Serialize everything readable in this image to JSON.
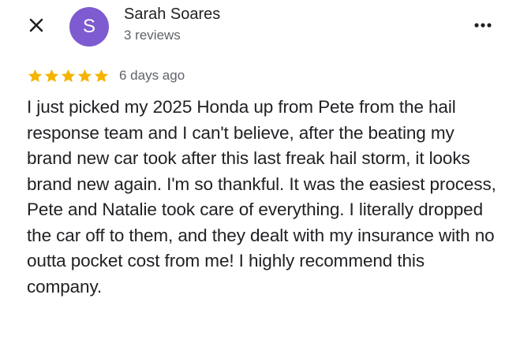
{
  "header": {
    "close_icon": "close-icon",
    "avatar_initial": "S",
    "avatar_color": "#7e5bd0",
    "author_name": "Sarah Soares",
    "author_meta": "3 reviews",
    "more_icon": "more-horizontal-icon"
  },
  "review": {
    "rating": 5,
    "rating_max": 5,
    "star_color": "#f4b400",
    "date": "6 days ago",
    "text": "I just picked my 2025 Honda up from Pete from the hail response team and I can't believe, after the beating my brand new car took after this last freak hail storm, it looks brand new again. I'm so thankful. It was the easiest process, Pete and Natalie took care of everything. I literally dropped the car off to them, and they dealt with my insurance with no outta pocket cost from me! I highly recommend this company."
  }
}
